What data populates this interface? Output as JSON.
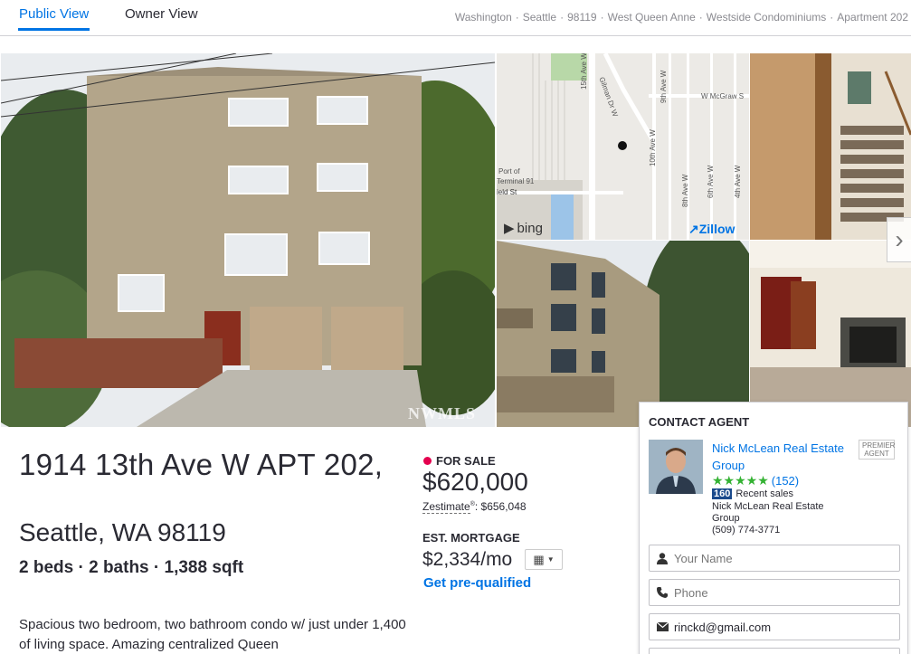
{
  "tabs": [
    {
      "label": "Public View"
    },
    {
      "label": "Owner View"
    }
  ],
  "breadcrumb": [
    "Washington",
    "Seattle",
    "98119",
    "West Queen Anne",
    "Westside Condominiums",
    "Apartment 202"
  ],
  "map": {
    "streets": [
      "15th Ave W",
      "Gilman Dr W",
      "9th Ave W",
      "W McGraw S",
      "10th Ave W",
      "8th Ave W",
      "6th Ave W",
      "4th Ave W"
    ],
    "labels": [
      "Port of",
      "Terminal 91",
      "ield St"
    ],
    "bing_label": "bing",
    "zillow_label": "Zillow"
  },
  "watermark": "NWMLS",
  "address": {
    "line1": "1914 13th Ave W APT 202,",
    "line2": "Seattle, WA 98119"
  },
  "facts": {
    "beds": "2 beds",
    "baths": "2 baths",
    "sqft": "1,388 sqft",
    "separator": "·"
  },
  "description": "Spacious two bedroom, two bathroom condo w/ just under 1,400 of living space. Amazing centralized Queen",
  "listing": {
    "status": "FOR SALE",
    "price": "$620,000",
    "zestimate_label": "Zestimate",
    "zestimate_suffix": ": $656,048",
    "est_mortgage_label": "EST. MORTGAGE",
    "mortgage": "$2,334/mo",
    "prequal_link": "Get pre-qualified"
  },
  "contact": {
    "title": "CONTACT AGENT",
    "agent_name": "Nick McLean Real Estate Group",
    "premier_badge": "PREMIER AGENT",
    "review_count": "(152)",
    "recent_sales_count": "160",
    "recent_sales_label": "Recent sales",
    "company": "Nick McLean Real Estate Group",
    "phone": "(509) 774-3771",
    "fields": {
      "name_placeholder": "Your Name",
      "phone_placeholder": "Phone",
      "email_value": "rinckd@gmail.com"
    }
  },
  "colors": {
    "accent": "#0074e4",
    "sale_dot": "#e4004e",
    "stars": "#34b233",
    "sales_badge": "#1b4a8c"
  },
  "icons": [
    "user-icon",
    "phone-icon",
    "envelope-icon",
    "calculator-icon",
    "chevron-right-icon",
    "map-pin-icon"
  ]
}
